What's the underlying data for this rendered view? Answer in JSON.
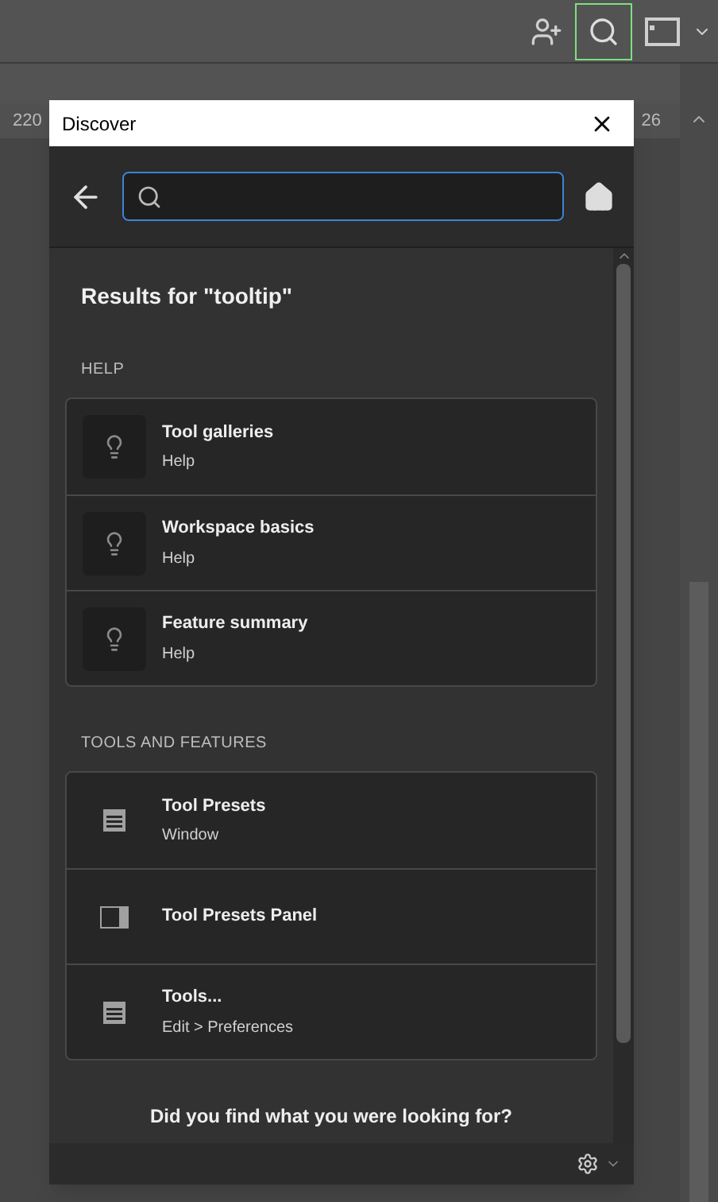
{
  "ruler": {
    "left_label": "220",
    "right_label": "26"
  },
  "dialog": {
    "title": "Discover",
    "results_title": "Results for \"tooltip\"",
    "sections": [
      {
        "heading": "HELP",
        "items": [
          {
            "kind": "help",
            "title": "Tool galleries",
            "subtitle": "Help"
          },
          {
            "kind": "help",
            "title": "Workspace basics",
            "subtitle": "Help"
          },
          {
            "kind": "help",
            "title": "Feature summary",
            "subtitle": "Help"
          }
        ]
      },
      {
        "heading": "TOOLS AND FEATURES",
        "items": [
          {
            "kind": "menu",
            "title": "Tool Presets",
            "subtitle": "Window"
          },
          {
            "kind": "panel",
            "title": "Tool Presets Panel"
          },
          {
            "kind": "menu",
            "title": "Tools...",
            "subtitle": "Edit > Preferences"
          }
        ]
      }
    ],
    "feedback_prompt": "Did you find what you were looking for?"
  }
}
